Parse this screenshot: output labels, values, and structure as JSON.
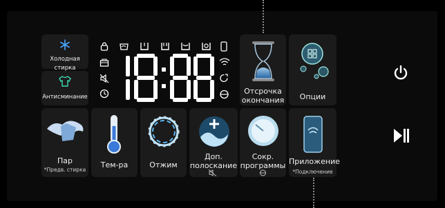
{
  "display": {
    "digits": "18:88"
  },
  "tiles": {
    "cold_wash": {
      "label": "Холодная стирка"
    },
    "anti_crease": {
      "label": "Антисминание"
    },
    "delay_end": {
      "label": "Отсрочка окончания",
      "line1": "Отсрочка",
      "line2": "окончания"
    },
    "options": {
      "label": "Опции"
    },
    "steam": {
      "label": "Пар",
      "sub": "*Предв. стирка"
    },
    "temperature": {
      "label": "Тем-ра"
    },
    "spin": {
      "label": "Отжим"
    },
    "extra_rinse": {
      "line1": "Доп.",
      "line2": "полоскание"
    },
    "short_programs": {
      "line1": "Сокр.",
      "line2": "программы"
    },
    "app": {
      "label": "Приложение",
      "sub": "*Подключение"
    }
  },
  "icons": {
    "status": [
      "lock-icon",
      "prewash-icon",
      "wash-icon",
      "rinse-icon",
      "spin-icon",
      "drum-icon",
      "phone-icon",
      "detergent-icon",
      "wifi-icon",
      "mute-icon",
      "smart-control-icon",
      "timer-icon",
      "eco-icon"
    ],
    "side": [
      "power-icon",
      "start-pause-icon"
    ]
  },
  "colors": {
    "background": "#000000",
    "tile": "#1b1b1b",
    "text": "#ffffff",
    "accent_blue": "#4aa8ff"
  }
}
